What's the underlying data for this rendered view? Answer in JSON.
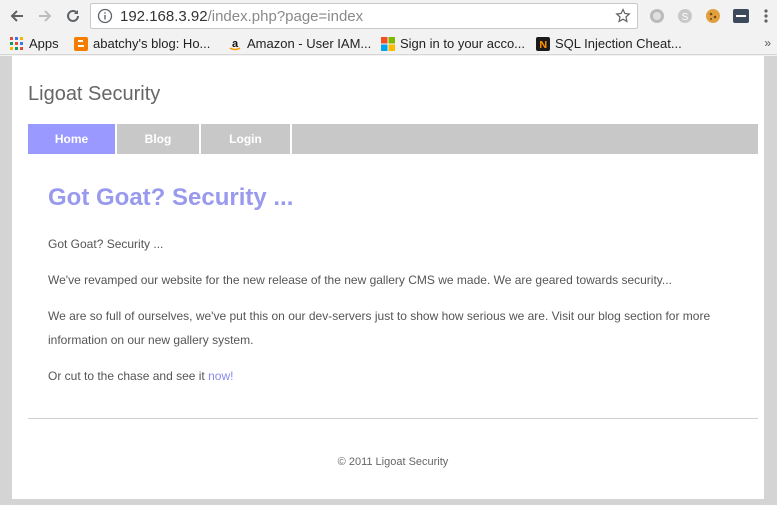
{
  "browser": {
    "url_host": "192.168.3.92",
    "url_path": "/index.php?page=index"
  },
  "bookmarks": [
    {
      "label": "Apps",
      "icon": "apps-grid-icon"
    },
    {
      "label": "abatchy's blog: Ho...",
      "icon": "blogger-icon"
    },
    {
      "label": "Amazon - User IAM...",
      "icon": "amazon-icon"
    },
    {
      "label": "Sign in to your acco...",
      "icon": "microsoft-icon"
    },
    {
      "label": "SQL Injection Cheat...",
      "icon": "netsparker-icon"
    }
  ],
  "site": {
    "title": "Ligoat Security",
    "menu": [
      {
        "label": "Home",
        "active": true
      },
      {
        "label": "Blog",
        "active": false
      },
      {
        "label": "Login",
        "active": false
      }
    ],
    "heading": "Got Goat? Security ...",
    "paragraphs": [
      "Got Goat? Security ...",
      "We've revamped our website for the new release of the new gallery CMS we made. We are geared towards security...",
      "We are so full of ourselves, we've put this on our dev-servers just to show how serious we are. Visit our blog section for more information on our new gallery system."
    ],
    "cta_text": "Or cut to the chase and see it ",
    "cta_link": "now!",
    "footer": "© 2011 Ligoat Security"
  },
  "colors": {
    "accent": "#9999ff",
    "heading": "#9999ee",
    "menu_bg": "#c8c8c8"
  }
}
